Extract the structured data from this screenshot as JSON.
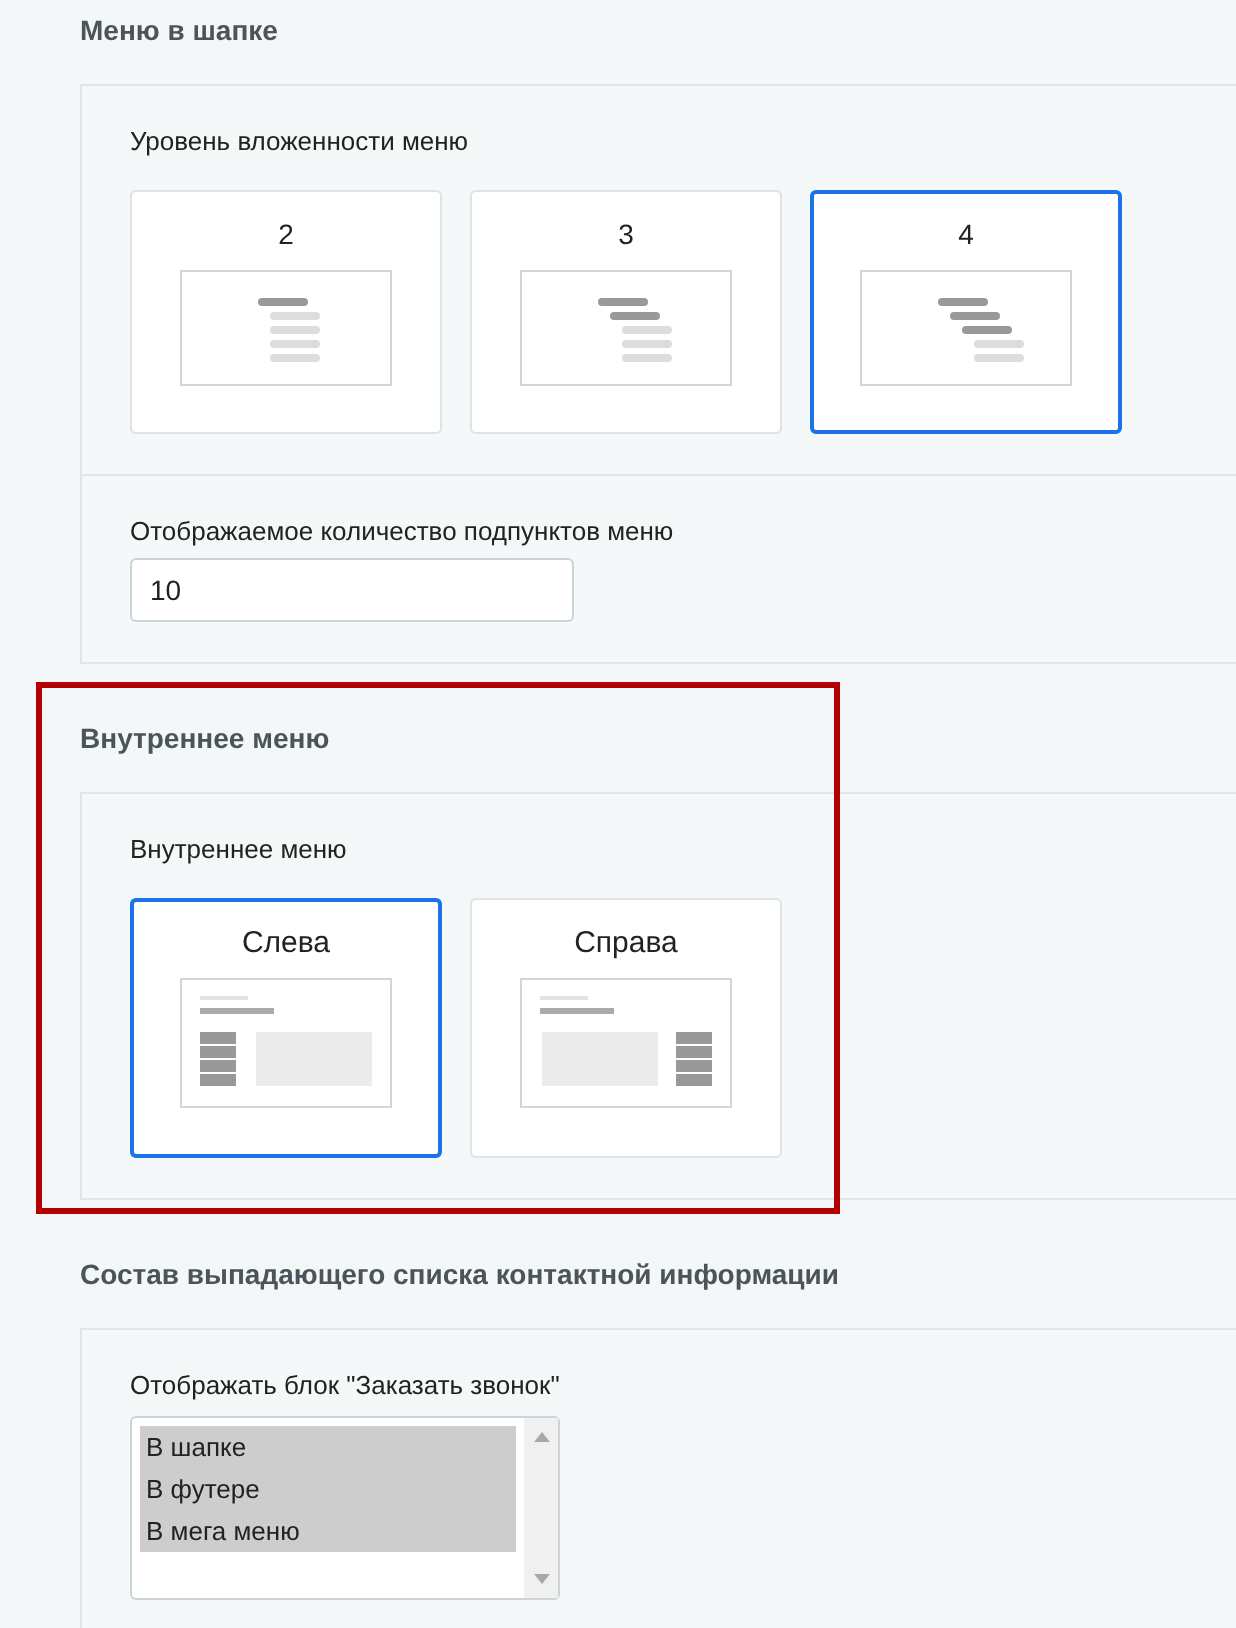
{
  "sections": [
    {
      "title": "Меню в шапке",
      "highlighted": false,
      "fields": [
        {
          "kind": "nesting-level",
          "label": "Уровень вложенности меню",
          "options": [
            {
              "label": "2",
              "selected": false
            },
            {
              "label": "3",
              "selected": false
            },
            {
              "label": "4",
              "selected": true
            }
          ]
        },
        {
          "kind": "text",
          "label": "Отображаемое количество подпунктов меню",
          "value": "10"
        }
      ]
    },
    {
      "title": "Внутреннее меню",
      "highlighted": true,
      "fields": [
        {
          "kind": "menu-side",
          "label": "Внутреннее меню",
          "options": [
            {
              "label": "Слева",
              "selected": true
            },
            {
              "label": "Справа",
              "selected": false
            }
          ]
        }
      ]
    },
    {
      "title": "Состав выпадающего списка контактной информации",
      "highlighted": false,
      "fields": [
        {
          "kind": "multiselect",
          "label": "Отображать блок \"Заказать звонок\"",
          "options": [
            {
              "label": "В шапке",
              "selected": true
            },
            {
              "label": "В футере",
              "selected": true
            },
            {
              "label": "В мега меню",
              "selected": true
            }
          ]
        }
      ]
    }
  ]
}
